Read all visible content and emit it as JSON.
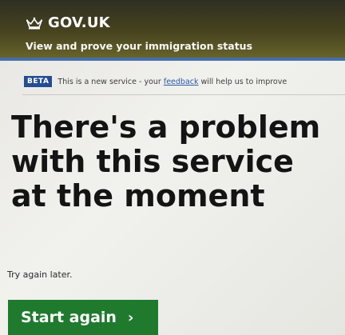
{
  "header": {
    "logo_text": "GOV.UK",
    "logo_icon": "crown-icon",
    "service_name": "View and prove your immigration status"
  },
  "phase_banner": {
    "tag": "BETA",
    "text_before": "This is a new service - your ",
    "link_text": "feedback",
    "text_after": " will help us to improve"
  },
  "main": {
    "heading": "There's a problem with this service at the moment",
    "body": "Try again later.",
    "button_label": "Start again",
    "button_icon": "chevron-right-icon"
  },
  "colors": {
    "header_bg": "#47431f",
    "header_border": "#466fa9",
    "beta_tag": "#244c93",
    "link": "#2a5aa8",
    "button_bg": "#1f7a2e"
  }
}
